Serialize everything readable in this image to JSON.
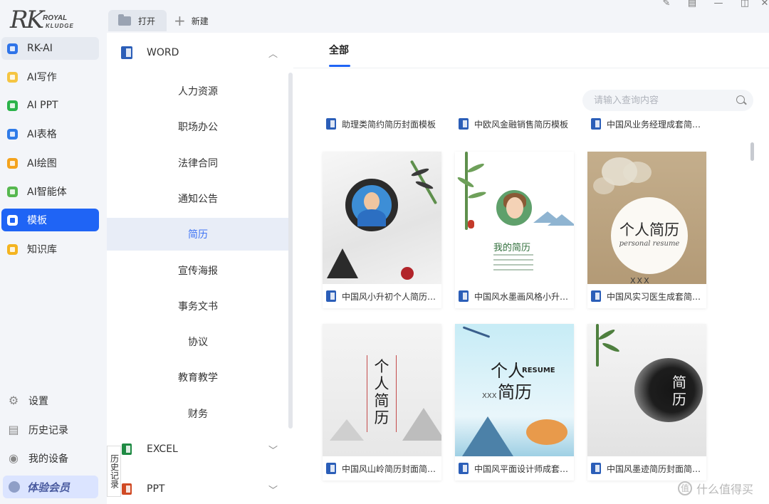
{
  "brand": {
    "logo_main": "RK",
    "logo_line1": "ROYAL",
    "logo_line2": "KLUDGE"
  },
  "nav": {
    "items": [
      {
        "label": "RK-AI",
        "icon": "rk-ai-icon",
        "color": "#2f74e8",
        "state": "hover"
      },
      {
        "label": "AI写作",
        "icon": "ai-writing-icon",
        "color": "#f5c542",
        "state": ""
      },
      {
        "label": "AI PPT",
        "icon": "ai-ppt-icon",
        "color": "#2bb34a",
        "state": ""
      },
      {
        "label": "AI表格",
        "icon": "ai-table-icon",
        "color": "#2f7be8",
        "state": ""
      },
      {
        "label": "AI绘图",
        "icon": "ai-drawing-icon",
        "color": "#f4a31d",
        "state": ""
      },
      {
        "label": "AI智能体",
        "icon": "ai-agent-icon",
        "color": "#56b84f",
        "state": ""
      },
      {
        "label": "模板",
        "icon": "template-icon",
        "color": "#1f64f5",
        "state": "active"
      },
      {
        "label": "知识库",
        "icon": "knowledge-base-icon",
        "color": "#f4b420",
        "state": ""
      }
    ],
    "bottom": [
      {
        "label": "设置",
        "icon": "gear-icon",
        "glyph": "⚙"
      },
      {
        "label": "历史记录",
        "icon": "history-icon",
        "glyph": "▤"
      },
      {
        "label": "我的设备",
        "icon": "device-icon",
        "glyph": "◉"
      }
    ],
    "member_label": "体验会员"
  },
  "tabs": {
    "open_label": "打开",
    "new_label": "新建"
  },
  "window_controls": [
    "edit-icon",
    "note-icon",
    "minimize-icon",
    "restore-icon",
    "close-icon"
  ],
  "category": {
    "word_label": "WORD",
    "items": [
      "人力资源",
      "职场办公",
      "法律合同",
      "通知公告",
      "简历",
      "宣传海报",
      "事务文书",
      "协议",
      "教育教学",
      "财务"
    ],
    "active": "简历",
    "excel_label": "EXCEL",
    "ppt_label": "PPT",
    "history_float": "历史记录"
  },
  "content": {
    "tab_all": "全部",
    "search_placeholder": "请输入查询内容",
    "top_row": [
      "助理类简约简历封面模板",
      "中欧风金融销售简历模板",
      "中国风业务经理成套简历模板"
    ],
    "cards": [
      {
        "title": "中国风小升初个人简历模板"
      },
      {
        "title": "中国风水墨画风格小升初简历",
        "thumb_title": "我的简历"
      },
      {
        "title": "中国风实习医生成套简历模板",
        "thumb_big": "个人简历",
        "thumb_small": "personal  resume",
        "thumb_name": "XXX"
      },
      {
        "title": "中国风山岭简历封面简约模板",
        "thumb_text": "个人简历"
      },
      {
        "title": "中国风平面设计师成套简历模板",
        "thumb_t1": "个人",
        "thumb_resume": "RESUME",
        "thumb_t2": "简历",
        "thumb_name": "XXX"
      },
      {
        "title": "中国风墨迹简历封面简约模板",
        "thumb_text": "简历"
      }
    ]
  },
  "watermark": {
    "icon": "zhidemai-icon",
    "glyph": "值",
    "text": "什么值得买"
  }
}
